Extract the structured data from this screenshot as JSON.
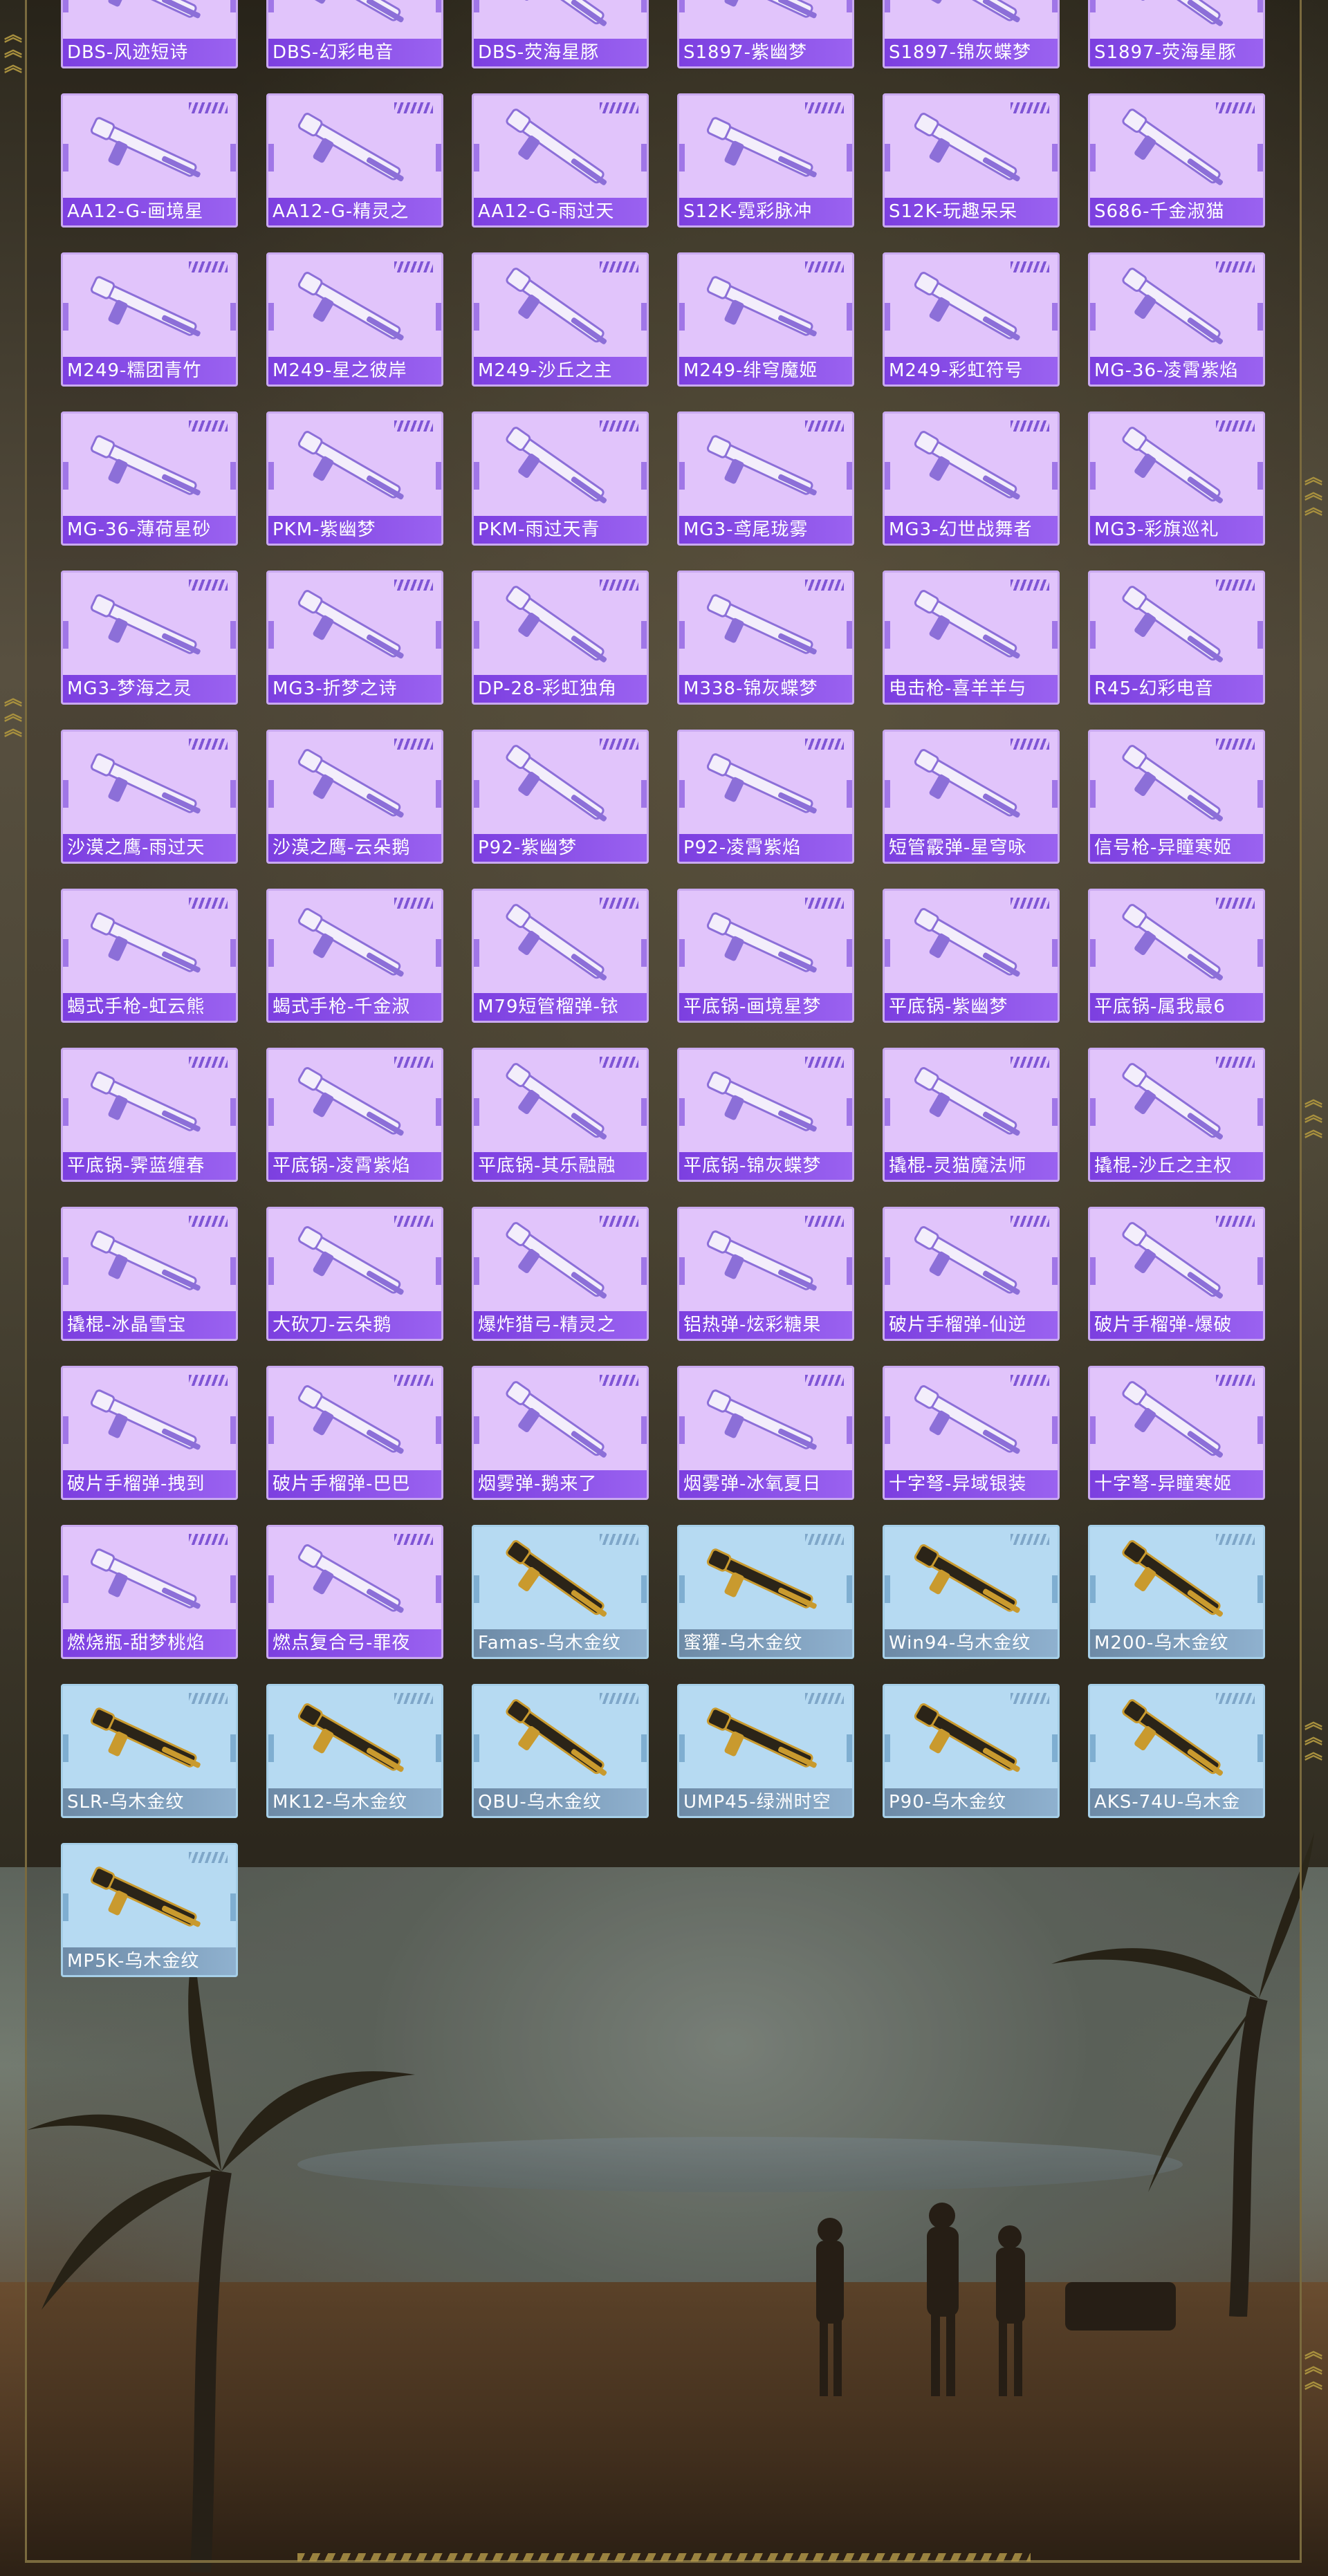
{
  "page": {
    "colors": {
      "purple_card": "#e1c4fb",
      "purple_label": "#7c3fe0",
      "blue_card": "#b6daf2",
      "blue_label": "#6d8aa6",
      "frame_gold": "#7a6a3e"
    }
  },
  "items": [
    {
      "label": "DBS-风迹短诗",
      "rarity": "purple",
      "icon": "shotgun-icon"
    },
    {
      "label": "DBS-幻彩电音",
      "rarity": "purple",
      "icon": "shotgun-icon"
    },
    {
      "label": "DBS-荧海星豚",
      "rarity": "purple",
      "icon": "shotgun-icon"
    },
    {
      "label": "S1897-紫幽梦",
      "rarity": "purple",
      "icon": "shotgun-icon"
    },
    {
      "label": "S1897-锦灰蝶梦",
      "rarity": "purple",
      "icon": "shotgun-icon"
    },
    {
      "label": "S1897-荧海星豚",
      "rarity": "purple",
      "icon": "shotgun-icon"
    },
    {
      "label": "AA12-G-画境星",
      "rarity": "purple",
      "icon": "shotgun-icon"
    },
    {
      "label": "AA12-G-精灵之",
      "rarity": "purple",
      "icon": "shotgun-icon"
    },
    {
      "label": "AA12-G-雨过天",
      "rarity": "purple",
      "icon": "shotgun-icon"
    },
    {
      "label": "S12K-霓彩脉冲",
      "rarity": "purple",
      "icon": "shotgun-icon"
    },
    {
      "label": "S12K-玩趣呆呆",
      "rarity": "purple",
      "icon": "shotgun-icon"
    },
    {
      "label": "S686-千金淑猫",
      "rarity": "purple",
      "icon": "shotgun-icon"
    },
    {
      "label": "M249-糯团青竹",
      "rarity": "purple",
      "icon": "machine-gun-icon"
    },
    {
      "label": "M249-星之彼岸",
      "rarity": "purple",
      "icon": "machine-gun-icon"
    },
    {
      "label": "M249-沙丘之主",
      "rarity": "purple",
      "icon": "machine-gun-icon"
    },
    {
      "label": "M249-绯穹魔姬",
      "rarity": "purple",
      "icon": "machine-gun-icon"
    },
    {
      "label": "M249-彩虹符号",
      "rarity": "purple",
      "icon": "machine-gun-icon"
    },
    {
      "label": "MG-36-凌霄紫焰",
      "rarity": "purple",
      "icon": "machine-gun-icon"
    },
    {
      "label": "MG-36-薄荷星砂",
      "rarity": "purple",
      "icon": "machine-gun-icon"
    },
    {
      "label": "PKM-紫幽梦",
      "rarity": "purple",
      "icon": "machine-gun-icon"
    },
    {
      "label": "PKM-雨过天青",
      "rarity": "purple",
      "icon": "machine-gun-icon"
    },
    {
      "label": "MG3-鸢尾珑雾",
      "rarity": "purple",
      "icon": "machine-gun-icon"
    },
    {
      "label": "MG3-幻世战舞者",
      "rarity": "purple",
      "icon": "machine-gun-icon"
    },
    {
      "label": "MG3-彩旗巡礼",
      "rarity": "purple",
      "icon": "machine-gun-icon"
    },
    {
      "label": "MG3-梦海之灵",
      "rarity": "purple",
      "icon": "machine-gun-icon"
    },
    {
      "label": "MG3-折梦之诗",
      "rarity": "purple",
      "icon": "machine-gun-icon"
    },
    {
      "label": "DP-28-彩虹独角",
      "rarity": "purple",
      "icon": "machine-gun-icon"
    },
    {
      "label": "M338-锦灰蝶梦",
      "rarity": "purple",
      "icon": "machine-gun-icon"
    },
    {
      "label": "电击枪-喜羊羊与",
      "rarity": "purple",
      "icon": "taser-icon"
    },
    {
      "label": "R45-幻彩电音",
      "rarity": "purple",
      "icon": "revolver-icon"
    },
    {
      "label": "沙漠之鹰-雨过天",
      "rarity": "purple",
      "icon": "pistol-icon"
    },
    {
      "label": "沙漠之鹰-云朵鹅",
      "rarity": "purple",
      "icon": "pistol-icon"
    },
    {
      "label": "P92-紫幽梦",
      "rarity": "purple",
      "icon": "pistol-icon"
    },
    {
      "label": "P92-凌霄紫焰",
      "rarity": "purple",
      "icon": "pistol-icon"
    },
    {
      "label": "短管霰弹-星穹咏",
      "rarity": "purple",
      "icon": "sawed-off-icon"
    },
    {
      "label": "信号枪-异瞳寒姬",
      "rarity": "purple",
      "icon": "flare-gun-icon"
    },
    {
      "label": "蝎式手枪-虹云熊",
      "rarity": "purple",
      "icon": "smg-icon"
    },
    {
      "label": "蝎式手枪-千金淑",
      "rarity": "purple",
      "icon": "smg-icon"
    },
    {
      "label": "M79短管榴弹-铱",
      "rarity": "purple",
      "icon": "launcher-icon"
    },
    {
      "label": "平底锅-画境星梦",
      "rarity": "purple",
      "icon": "pan-icon"
    },
    {
      "label": "平底锅-紫幽梦",
      "rarity": "purple",
      "icon": "pan-icon"
    },
    {
      "label": "平底锅-属我最6",
      "rarity": "purple",
      "icon": "pan-icon"
    },
    {
      "label": "平底锅-霁蓝缠春",
      "rarity": "purple",
      "icon": "pan-icon"
    },
    {
      "label": "平底锅-凌霄紫焰",
      "rarity": "purple",
      "icon": "pan-icon"
    },
    {
      "label": "平底锅-其乐融融",
      "rarity": "purple",
      "icon": "pan-icon"
    },
    {
      "label": "平底锅-锦灰蝶梦",
      "rarity": "purple",
      "icon": "pan-icon"
    },
    {
      "label": "撬棍-灵猫魔法师",
      "rarity": "purple",
      "icon": "crowbar-icon"
    },
    {
      "label": "撬棍-沙丘之主权",
      "rarity": "purple",
      "icon": "crowbar-icon"
    },
    {
      "label": "撬棍-冰晶雪宝",
      "rarity": "purple",
      "icon": "crowbar-icon"
    },
    {
      "label": "大砍刀-云朵鹅",
      "rarity": "purple",
      "icon": "machete-icon"
    },
    {
      "label": "爆炸猎弓-精灵之",
      "rarity": "purple",
      "icon": "bow-icon"
    },
    {
      "label": "铝热弹-炫彩糖果",
      "rarity": "purple",
      "icon": "thermite-icon"
    },
    {
      "label": "破片手榴弹-仙逆",
      "rarity": "purple",
      "icon": "grenade-icon"
    },
    {
      "label": "破片手榴弹-爆破",
      "rarity": "purple",
      "icon": "grenade-icon"
    },
    {
      "label": "破片手榴弹-拽到",
      "rarity": "purple",
      "icon": "grenade-icon"
    },
    {
      "label": "破片手榴弹-巴巴",
      "rarity": "purple",
      "icon": "grenade-icon"
    },
    {
      "label": "烟雾弹-鹅来了",
      "rarity": "purple",
      "icon": "smoke-grenade-icon"
    },
    {
      "label": "烟雾弹-冰氧夏日",
      "rarity": "purple",
      "icon": "smoke-grenade-icon"
    },
    {
      "label": "十字弩-异域银装",
      "rarity": "purple",
      "icon": "crossbow-icon"
    },
    {
      "label": "十字弩-异瞳寒姬",
      "rarity": "purple",
      "icon": "crossbow-icon"
    },
    {
      "label": "燃烧瓶-甜梦桃焰",
      "rarity": "purple",
      "icon": "molotov-icon"
    },
    {
      "label": "燃点复合弓-罪夜",
      "rarity": "purple",
      "icon": "compound-bow-icon"
    },
    {
      "label": "Famas-乌木金纹",
      "rarity": "blue",
      "icon": "rifle-icon"
    },
    {
      "label": "蜜獾-乌木金纹",
      "rarity": "blue",
      "icon": "smg-icon"
    },
    {
      "label": "Win94-乌木金纹",
      "rarity": "blue",
      "icon": "rifle-icon"
    },
    {
      "label": "M200-乌木金纹",
      "rarity": "blue",
      "icon": "sniper-icon"
    },
    {
      "label": "SLR-乌木金纹",
      "rarity": "blue",
      "icon": "rifle-icon"
    },
    {
      "label": "MK12-乌木金纹",
      "rarity": "blue",
      "icon": "rifle-icon"
    },
    {
      "label": "QBU-乌木金纹",
      "rarity": "blue",
      "icon": "rifle-icon"
    },
    {
      "label": "UMP45-绿洲时空",
      "rarity": "blue",
      "icon": "smg-icon"
    },
    {
      "label": "P90-乌木金纹",
      "rarity": "blue",
      "icon": "smg-icon"
    },
    {
      "label": "AKS-74U-乌木金",
      "rarity": "blue",
      "icon": "rifle-icon"
    },
    {
      "label": "MP5K-乌木金纹",
      "rarity": "blue",
      "icon": "smg-icon"
    }
  ]
}
